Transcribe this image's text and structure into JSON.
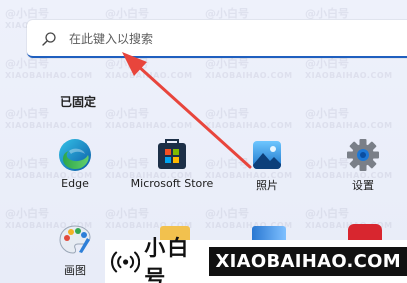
{
  "search": {
    "placeholder": "在此键入以搜索"
  },
  "pinned": {
    "title": "已固定",
    "apps": [
      {
        "label": "Edge",
        "icon": "edge-icon"
      },
      {
        "label": "Microsoft Store",
        "icon": "store-icon"
      },
      {
        "label": "照片",
        "icon": "photos-icon"
      },
      {
        "label": "设置",
        "icon": "settings-gear-icon"
      },
      {
        "label": "画图",
        "icon": "paint-icon"
      }
    ]
  },
  "watermark": {
    "brand": "@小白号",
    "url": "XIAOBAIHAO.COM"
  },
  "banner": {
    "brand": "小白号",
    "url": "XIAOBAIHAO.COM"
  },
  "colors": {
    "accent": "#1f5fbf",
    "arrow": "#e8453c",
    "background": "#eef1fb"
  }
}
